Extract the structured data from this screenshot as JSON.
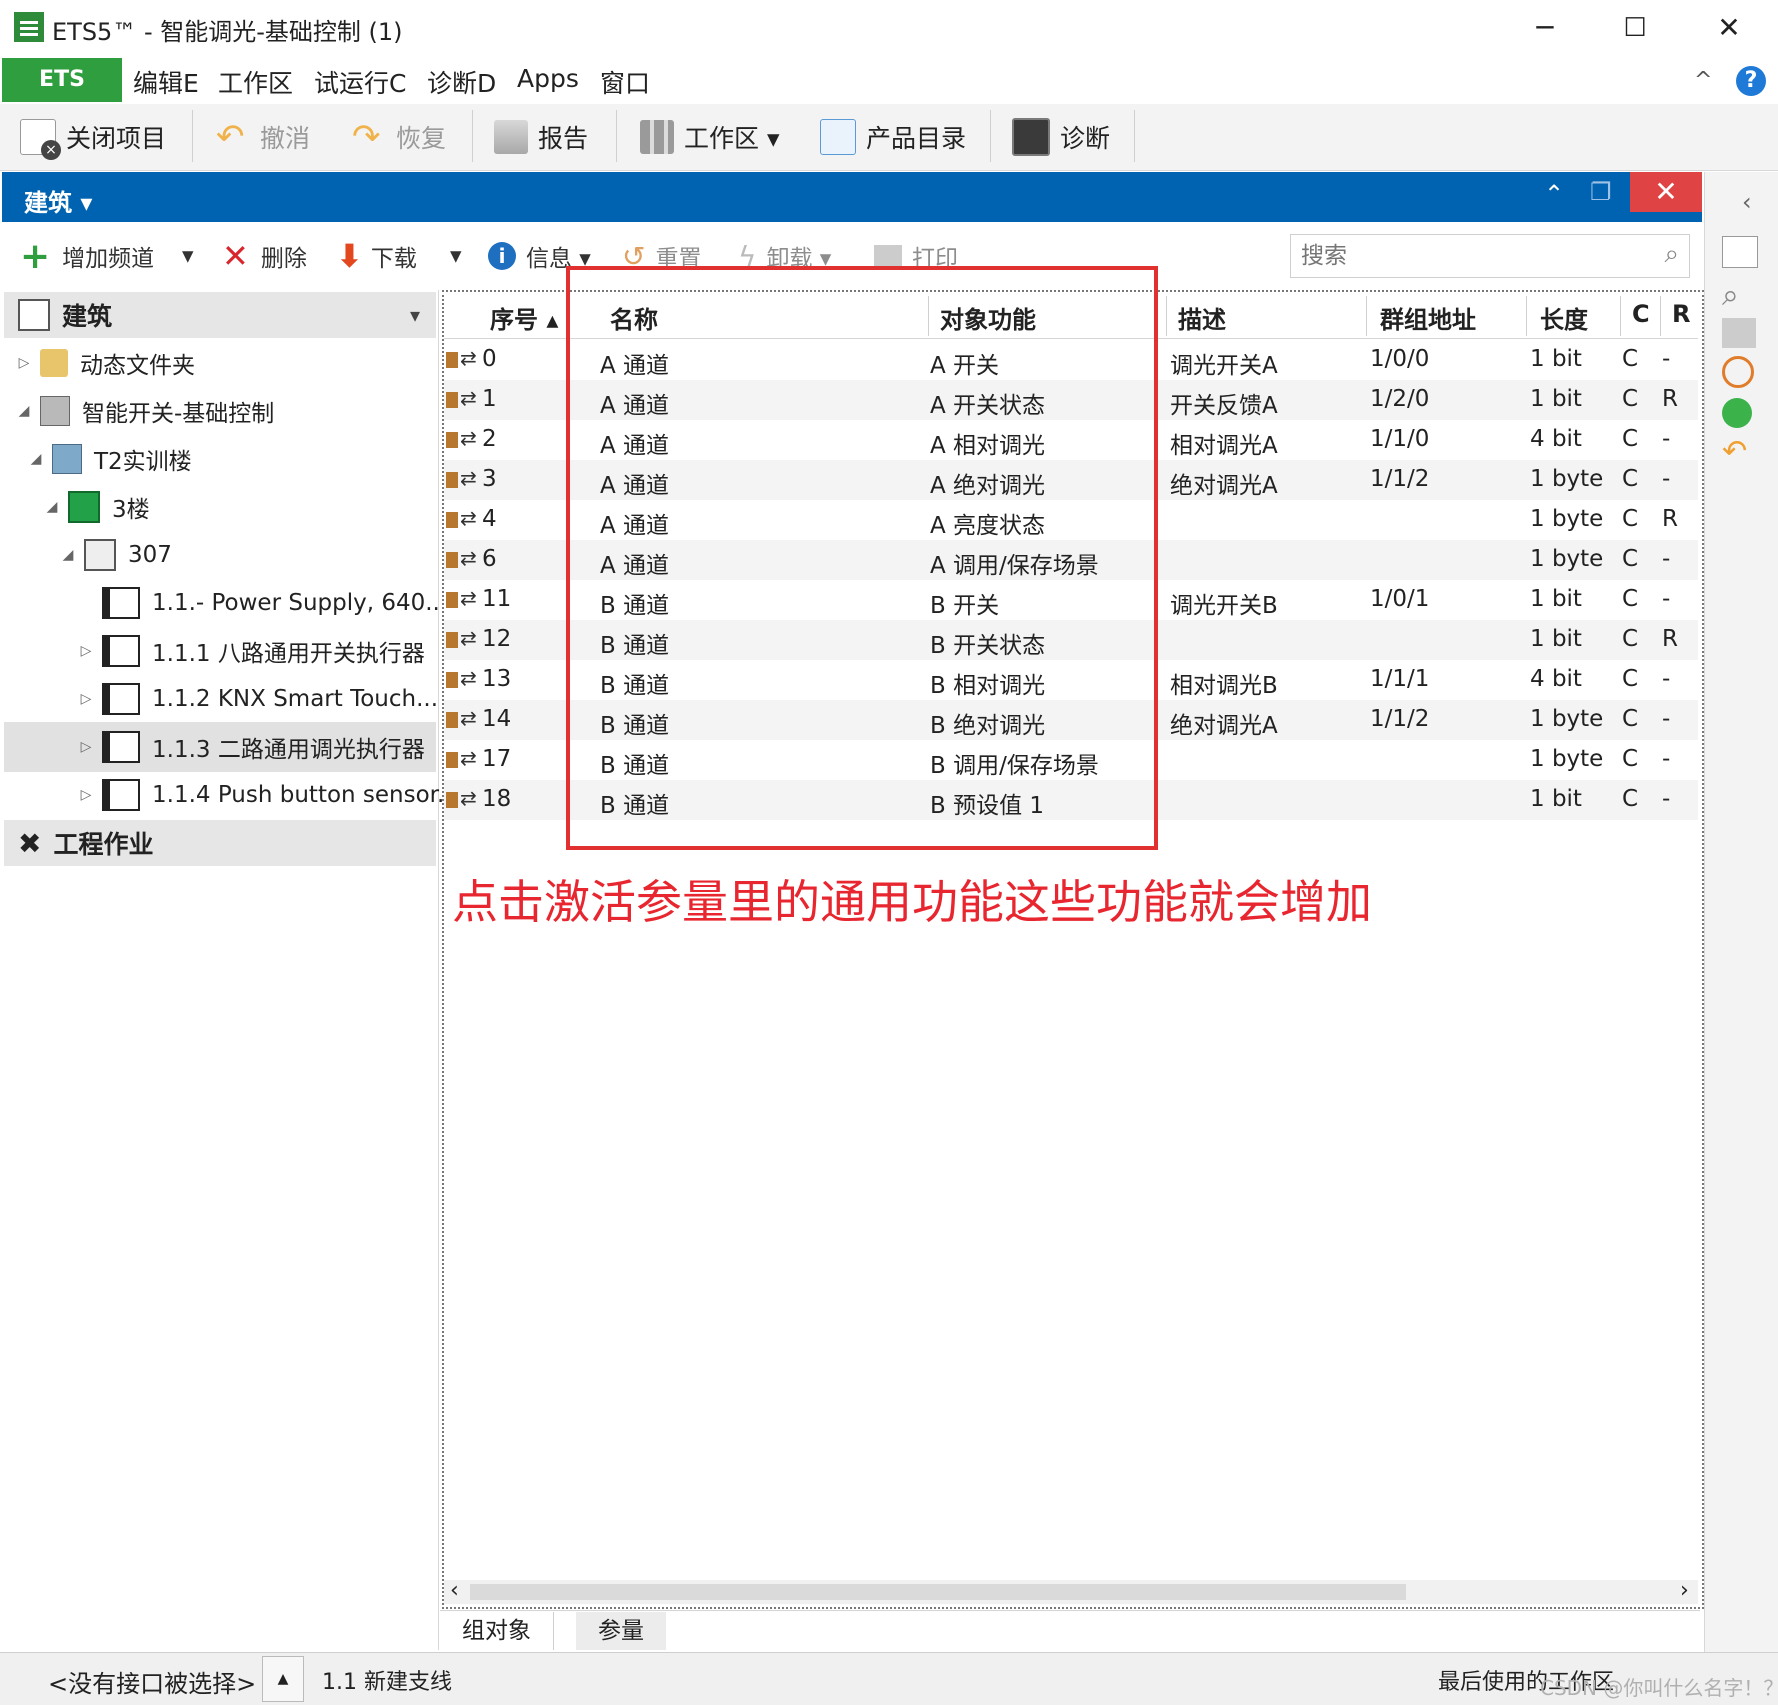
{
  "window": {
    "title": "ETS5™ - 智能调光-基础控制 (1)",
    "minimize": "─",
    "maximize": "☐",
    "close": "✕"
  },
  "menu": {
    "ets": "ETS",
    "items": [
      "编辑E",
      "工作区",
      "试运行C",
      "诊断D",
      "Apps",
      "窗口"
    ],
    "help": "?",
    "collapse": "^"
  },
  "toolbar": [
    {
      "label": "关闭项目",
      "enabled": true
    },
    {
      "label": "撤消",
      "enabled": false
    },
    {
      "label": "恢复",
      "enabled": false
    },
    {
      "label": "报告",
      "enabled": true
    },
    {
      "label": "工作区 ▾",
      "enabled": true
    },
    {
      "label": "产品目录",
      "enabled": true
    },
    {
      "label": "诊断",
      "enabled": true
    }
  ],
  "panel": {
    "title": "建筑 ▾",
    "close": "✕",
    "up": "⌃",
    "restore": "❐"
  },
  "subtoolbar": [
    {
      "label": "增加频道",
      "enabled": true
    },
    {
      "label": "▾",
      "enabled": true
    },
    {
      "label": "删除",
      "enabled": true
    },
    {
      "label": "下载",
      "enabled": true
    },
    {
      "label": "▾",
      "enabled": true
    },
    {
      "label": "信息 ▾",
      "enabled": true
    },
    {
      "label": "重置",
      "enabled": false
    },
    {
      "label": "卸载 ▾",
      "enabled": false
    },
    {
      "label": "打印",
      "enabled": false
    }
  ],
  "search": {
    "placeholder": "搜索"
  },
  "tree": {
    "section_building": "建筑",
    "section_dropdown": "▾",
    "items": [
      {
        "label": "动态文件夹",
        "arrow": "▷"
      },
      {
        "label": "智能开关-基础控制",
        "arrow": "◢"
      },
      {
        "label": "T2实训楼",
        "arrow": "◢"
      },
      {
        "label": "3楼",
        "arrow": "◢"
      },
      {
        "label": "307",
        "arrow": "◢"
      },
      {
        "label": "1.1.- Power Supply, 640...",
        "arrow": ""
      },
      {
        "label": "1.1.1 八路通用开关执行器",
        "arrow": "▷"
      },
      {
        "label": "1.1.2 KNX Smart Touch...",
        "arrow": "▷"
      },
      {
        "label": "1.1.3 二路通用调光执行器",
        "arrow": "▷"
      },
      {
        "label": "1.1.4 Push button sensor...",
        "arrow": "▷"
      }
    ],
    "section_work": "工程作业"
  },
  "table": {
    "headers": [
      "序号 ▴",
      "名称",
      "对象功能",
      "描述",
      "群组地址",
      "长度",
      "C",
      "R"
    ],
    "rows": [
      {
        "no": "0",
        "name": "A 通道",
        "func": "A 开关",
        "desc": "调光开关A",
        "addr": "1/0/0",
        "len": "1 bit",
        "c": "C",
        "r": "-"
      },
      {
        "no": "1",
        "name": "A 通道",
        "func": "A 开关状态",
        "desc": "开关反馈A",
        "addr": "1/2/0",
        "len": "1 bit",
        "c": "C",
        "r": "R"
      },
      {
        "no": "2",
        "name": "A 通道",
        "func": "A 相对调光",
        "desc": "相对调光A",
        "addr": "1/1/0",
        "len": "4 bit",
        "c": "C",
        "r": "-"
      },
      {
        "no": "3",
        "name": "A 通道",
        "func": "A 绝对调光",
        "desc": "绝对调光A",
        "addr": "1/1/2",
        "len": "1 byte",
        "c": "C",
        "r": "-"
      },
      {
        "no": "4",
        "name": "A 通道",
        "func": "A 亮度状态",
        "desc": "",
        "addr": "",
        "len": "1 byte",
        "c": "C",
        "r": "R"
      },
      {
        "no": "6",
        "name": "A 通道",
        "func": "A 调用/保存场景",
        "desc": "",
        "addr": "",
        "len": "1 byte",
        "c": "C",
        "r": "-"
      },
      {
        "no": "11",
        "name": "B 通道",
        "func": "B 开关",
        "desc": "调光开关B",
        "addr": "1/0/1",
        "len": "1 bit",
        "c": "C",
        "r": "-"
      },
      {
        "no": "12",
        "name": "B 通道",
        "func": "B 开关状态",
        "desc": "",
        "addr": "",
        "len": "1 bit",
        "c": "C",
        "r": "R"
      },
      {
        "no": "13",
        "name": "B 通道",
        "func": "B 相对调光",
        "desc": "相对调光B",
        "addr": "1/1/1",
        "len": "4 bit",
        "c": "C",
        "r": "-"
      },
      {
        "no": "14",
        "name": "B 通道",
        "func": "B 绝对调光",
        "desc": "绝对调光A",
        "addr": "1/1/2",
        "len": "1 byte",
        "c": "C",
        "r": "-"
      },
      {
        "no": "17",
        "name": "B 通道",
        "func": "B 调用/保存场景",
        "desc": "",
        "addr": "",
        "len": "1 byte",
        "c": "C",
        "r": "-"
      },
      {
        "no": "18",
        "name": "B 通道",
        "func": "B 预设值 1",
        "desc": "",
        "addr": "",
        "len": "1 bit",
        "c": "C",
        "r": "-"
      }
    ]
  },
  "annotation": "点击激活参量里的通用功能这些功能就会增加",
  "scroll": {
    "left": "‹",
    "right": "›"
  },
  "tabs": [
    "组对象",
    "参量"
  ],
  "status": {
    "interface": "<没有接口被选择>",
    "up": "▲",
    "line": "1.1 新建支线",
    "workspace": "最后使用的工作区",
    "watermark": "CSDN @你叫什么名字！？"
  },
  "colors": {
    "accent_green": "#2f9e3e",
    "panel_blue": "#0063b1",
    "close_red": "#e04343",
    "annotation_red": "#e8262f"
  }
}
